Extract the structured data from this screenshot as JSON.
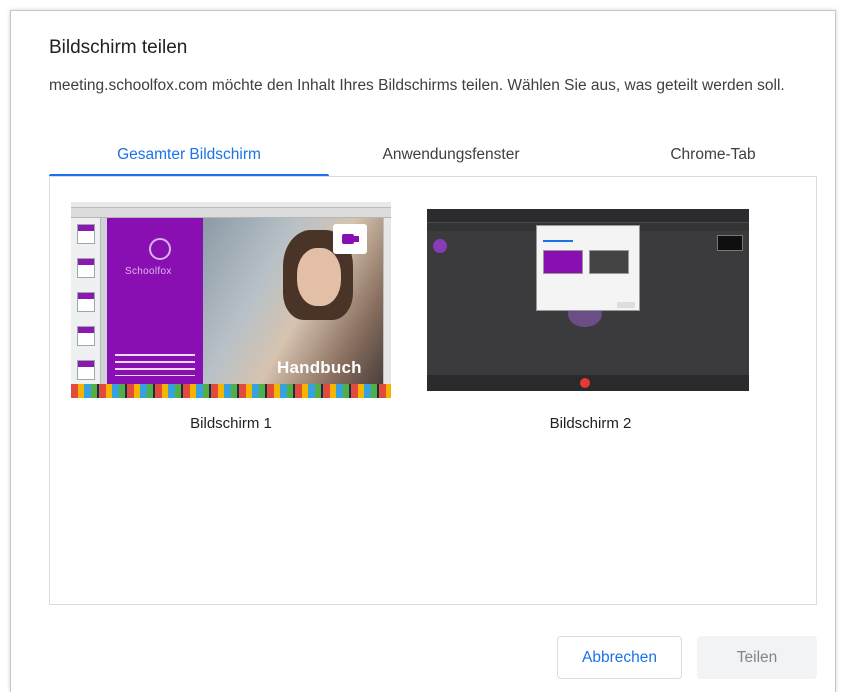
{
  "dialog": {
    "title": "Bildschirm teilen",
    "description": "meeting.schoolfox.com möchte den Inhalt Ihres Bildschirms teilen. Wählen Sie aus, was geteilt werden soll."
  },
  "tabs": [
    {
      "label": "Gesamter Bildschirm",
      "selected": true
    },
    {
      "label": "Anwendungsfenster",
      "selected": false
    },
    {
      "label": "Chrome-Tab",
      "selected": false
    }
  ],
  "sources": [
    {
      "label": "Bildschirm 1",
      "thumbnail_text": {
        "brand": "Schoolfox",
        "headline": "Handbuch"
      }
    },
    {
      "label": "Bildschirm 2"
    }
  ],
  "buttons": {
    "cancel": "Abbrechen",
    "share": "Teilen"
  },
  "colors": {
    "accent": "#1a73e8",
    "brand_purple": "#8a0fb3",
    "disabled_bg": "#f1f3f4",
    "disabled_text": "#80868b"
  }
}
